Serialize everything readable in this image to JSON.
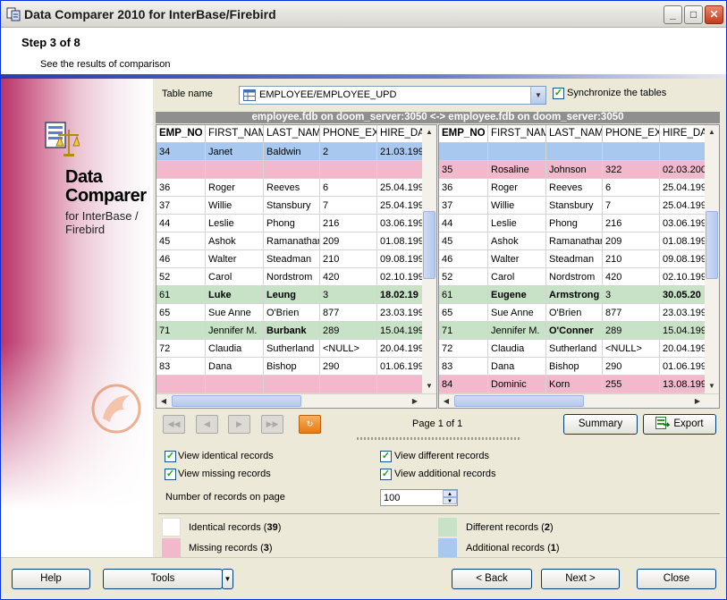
{
  "window": {
    "title": "Data Comparer 2010 for InterBase/Firebird"
  },
  "header": {
    "step": "Step 3 of 8",
    "subtitle": "See the results of comparison"
  },
  "side_panel": {
    "product_name": "Data Comparer",
    "product_for": "for InterBase / Firebird"
  },
  "table_select": {
    "label": "Table name",
    "value": "EMPLOYEE/EMPLOYEE_UPD"
  },
  "sync": {
    "label": "Synchronize the tables",
    "checked": true
  },
  "grid": {
    "caption": "employee.fdb on doom_server:3050 <-> employee.fdb on doom_server:3050",
    "columns": [
      "EMP_NO",
      "FIRST_NAM",
      "LAST_NAM",
      "PHONE_EX",
      "HIRE_DA"
    ],
    "left_rows": [
      {
        "status": "additional",
        "cells": [
          "34",
          "Janet",
          "Baldwin",
          "2",
          "21.03.199"
        ],
        "bold": []
      },
      {
        "status": "missing",
        "cells": [
          "",
          "",
          "",
          "",
          ""
        ],
        "bold": []
      },
      {
        "status": "identical",
        "cells": [
          "36",
          "Roger",
          "Reeves",
          "6",
          "25.04.199"
        ],
        "bold": []
      },
      {
        "status": "identical",
        "cells": [
          "37",
          "Willie",
          "Stansbury",
          "7",
          "25.04.199"
        ],
        "bold": []
      },
      {
        "status": "identical",
        "cells": [
          "44",
          "Leslie",
          "Phong",
          "216",
          "03.06.199"
        ],
        "bold": []
      },
      {
        "status": "identical",
        "cells": [
          "45",
          "Ashok",
          "Ramanathar",
          "209",
          "01.08.199"
        ],
        "bold": []
      },
      {
        "status": "identical",
        "cells": [
          "46",
          "Walter",
          "Steadman",
          "210",
          "09.08.199"
        ],
        "bold": []
      },
      {
        "status": "identical",
        "cells": [
          "52",
          "Carol",
          "Nordstrom",
          "420",
          "02.10.199"
        ],
        "bold": []
      },
      {
        "status": "different",
        "cells": [
          "61",
          "Luke",
          "Leung",
          "3",
          "18.02.19"
        ],
        "bold": [
          1,
          2,
          4
        ]
      },
      {
        "status": "identical",
        "cells": [
          "65",
          "Sue Anne",
          "O'Brien",
          "877",
          "23.03.199"
        ],
        "bold": []
      },
      {
        "status": "different",
        "cells": [
          "71",
          "Jennifer M.",
          "Burbank",
          "289",
          "15.04.199"
        ],
        "bold": [
          2
        ]
      },
      {
        "status": "identical",
        "cells": [
          "72",
          "Claudia",
          "Sutherland",
          "<NULL>",
          "20.04.199"
        ],
        "bold": []
      },
      {
        "status": "identical",
        "cells": [
          "83",
          "Dana",
          "Bishop",
          "290",
          "01.06.199"
        ],
        "bold": []
      },
      {
        "status": "missing",
        "cells": [
          "",
          "",
          "",
          "",
          ""
        ],
        "bold": []
      }
    ],
    "right_rows": [
      {
        "status": "additional",
        "cells": [
          "",
          "",
          "",
          "",
          ""
        ],
        "bold": []
      },
      {
        "status": "missing",
        "cells": [
          "35",
          "Rosaline",
          "Johnson",
          "322",
          "02.03.200"
        ],
        "bold": []
      },
      {
        "status": "identical",
        "cells": [
          "36",
          "Roger",
          "Reeves",
          "6",
          "25.04.199"
        ],
        "bold": []
      },
      {
        "status": "identical",
        "cells": [
          "37",
          "Willie",
          "Stansbury",
          "7",
          "25.04.199"
        ],
        "bold": []
      },
      {
        "status": "identical",
        "cells": [
          "44",
          "Leslie",
          "Phong",
          "216",
          "03.06.199"
        ],
        "bold": []
      },
      {
        "status": "identical",
        "cells": [
          "45",
          "Ashok",
          "Ramanathar",
          "209",
          "01.08.199"
        ],
        "bold": []
      },
      {
        "status": "identical",
        "cells": [
          "46",
          "Walter",
          "Steadman",
          "210",
          "09.08.199"
        ],
        "bold": []
      },
      {
        "status": "identical",
        "cells": [
          "52",
          "Carol",
          "Nordstrom",
          "420",
          "02.10.199"
        ],
        "bold": []
      },
      {
        "status": "different",
        "cells": [
          "61",
          "Eugene",
          "Armstrong",
          "3",
          "30.05.20"
        ],
        "bold": [
          1,
          2,
          4
        ]
      },
      {
        "status": "identical",
        "cells": [
          "65",
          "Sue Anne",
          "O'Brien",
          "877",
          "23.03.199"
        ],
        "bold": []
      },
      {
        "status": "different",
        "cells": [
          "71",
          "Jennifer M.",
          "O'Conner",
          "289",
          "15.04.199"
        ],
        "bold": [
          2
        ]
      },
      {
        "status": "identical",
        "cells": [
          "72",
          "Claudia",
          "Sutherland",
          "<NULL>",
          "20.04.199"
        ],
        "bold": []
      },
      {
        "status": "identical",
        "cells": [
          "83",
          "Dana",
          "Bishop",
          "290",
          "01.06.199"
        ],
        "bold": []
      },
      {
        "status": "missing",
        "cells": [
          "84",
          "Dominic",
          "Korn",
          "255",
          "13.08.199"
        ],
        "bold": []
      }
    ]
  },
  "pager": {
    "info": "Page 1 of 1",
    "summary_label": "Summary",
    "export_label": "Export"
  },
  "filters": {
    "identical": {
      "label": "View identical records",
      "checked": true
    },
    "missing": {
      "label": "View missing records",
      "checked": true
    },
    "different": {
      "label": "View different records",
      "checked": true
    },
    "additional": {
      "label": "View additional records",
      "checked": true
    }
  },
  "records_on_page": {
    "label": "Number of records on page",
    "value": "100"
  },
  "legend": {
    "identical": {
      "label": "Identical records",
      "count": "39",
      "color": "#ffffff"
    },
    "different": {
      "label": "Different records",
      "count": "2",
      "color": "#c7e2c7"
    },
    "missing": {
      "label": "Missing records",
      "count": "3",
      "color": "#f2b8cc"
    },
    "additional": {
      "label": "Additional records",
      "count": "1",
      "color": "#a9c8ef"
    }
  },
  "footer": {
    "help": "Help",
    "tools": "Tools",
    "back": "< Back",
    "next": "Next >",
    "close": "Close"
  }
}
